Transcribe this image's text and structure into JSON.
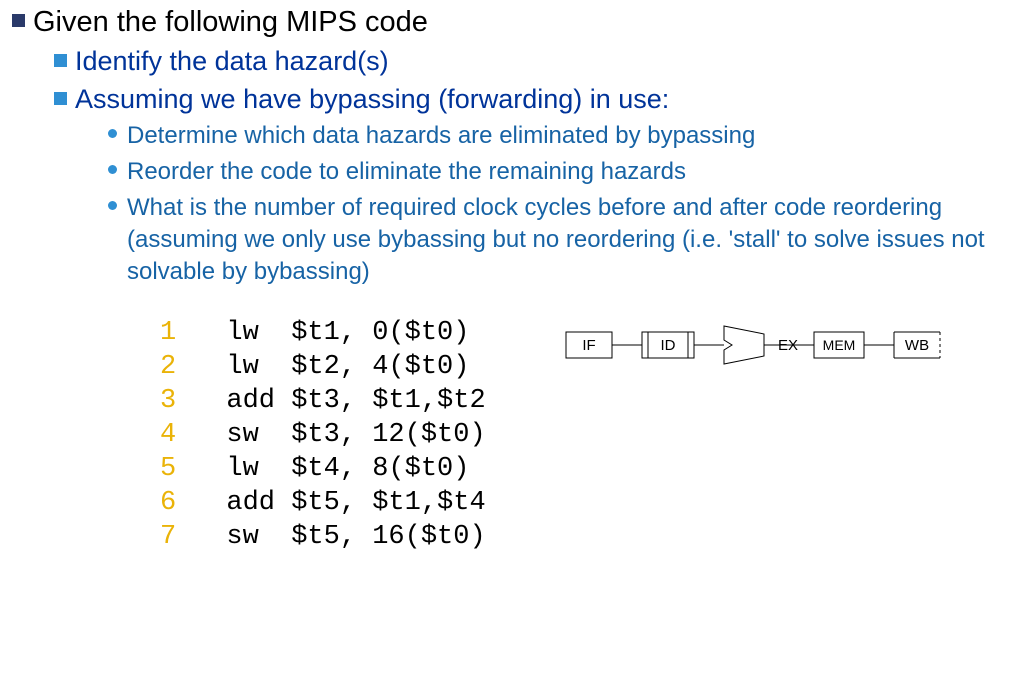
{
  "sq_color_main": "#2a3a6a",
  "sq_color_sub": "#2f8fd3",
  "dot_color": "#2f8fd3",
  "b1": "Given the following MIPS code",
  "b2": "Identify the data hazard(s)",
  "b3": "Assuming we have bypassing (forwarding) in use:",
  "b3a": "Determine which data hazards are eliminated by bypassing",
  "b3b": "Reorder the code to eliminate the remaining hazards",
  "b3c": "What is the number of required clock cycles before and after code reordering (assuming we only use bybassing but no reordering (i.e. 'stall' to solve issues not solvable by bybassing)",
  "code": {
    "lines": [
      {
        "n": "1",
        "t": "lw  $t1, 0($t0)"
      },
      {
        "n": "2",
        "t": "lw  $t2, 4($t0)"
      },
      {
        "n": "3",
        "t": "add $t3, $t1,$t2"
      },
      {
        "n": "4",
        "t": "sw  $t3, 12($t0)"
      },
      {
        "n": "5",
        "t": "lw  $t4, 8($t0)"
      },
      {
        "n": "6",
        "t": "add $t5, $t1,$t4"
      },
      {
        "n": "7",
        "t": "sw  $t5, 16($t0)"
      }
    ]
  },
  "pipeline": {
    "stages": [
      "IF",
      "ID",
      "EX",
      "MEM",
      "WB"
    ]
  }
}
